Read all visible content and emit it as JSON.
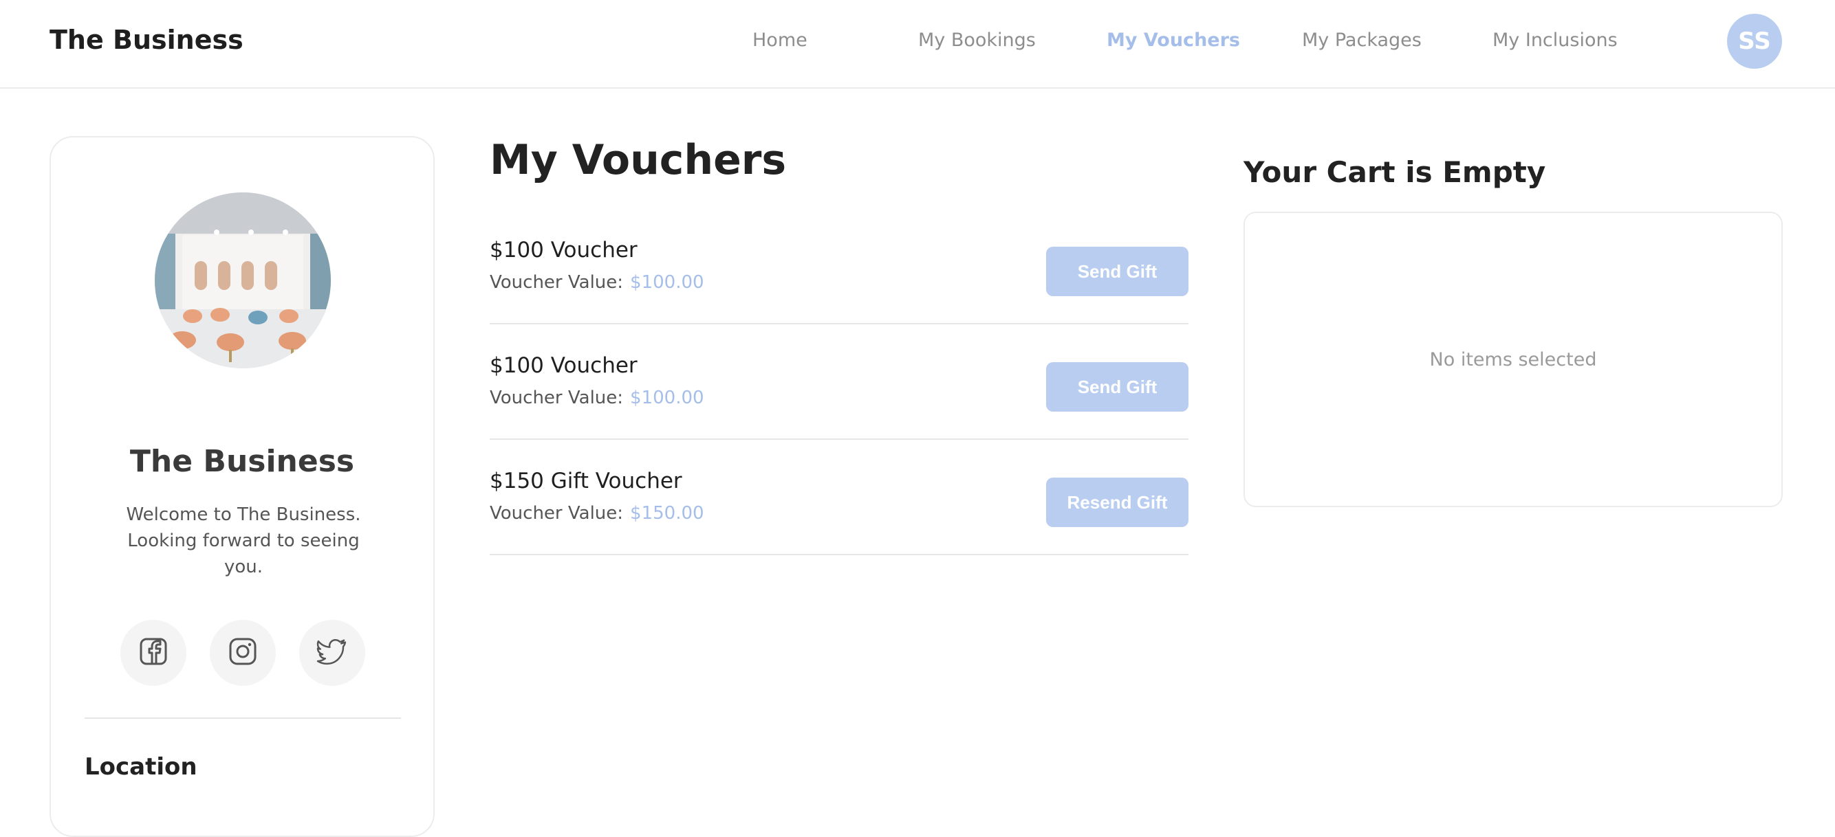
{
  "header": {
    "brand": "The Business",
    "nav": [
      {
        "label": "Home"
      },
      {
        "label": "My Bookings"
      },
      {
        "label": "My Vouchers"
      },
      {
        "label": "My Packages"
      },
      {
        "label": "My Inclusions"
      }
    ],
    "active_nav": "My Vouchers",
    "avatar_initials": "SS"
  },
  "profile": {
    "name": "The Business",
    "welcome": "Welcome to The Business. Looking forward to seeing you.",
    "social": [
      "facebook-icon",
      "instagram-icon",
      "twitter-icon"
    ],
    "location_title": "Location"
  },
  "main": {
    "title": "My Vouchers",
    "vouchers": [
      {
        "name": "$100 Voucher",
        "value_label": "Voucher Value:",
        "value": "$100.00",
        "action": "Send Gift"
      },
      {
        "name": "$100 Voucher",
        "value_label": "Voucher Value:",
        "value": "$100.00",
        "action": "Send Gift"
      },
      {
        "name": "$150 Gift Voucher",
        "value_label": "Voucher Value:",
        "value": "$150.00",
        "action": "Resend Gift"
      }
    ]
  },
  "cart": {
    "title": "Your Cart is Empty",
    "empty_text": "No items selected"
  },
  "colors": {
    "accent": "#a5bee9",
    "button_bg": "#b8cdf0",
    "muted_text": "#8d8d8d"
  }
}
